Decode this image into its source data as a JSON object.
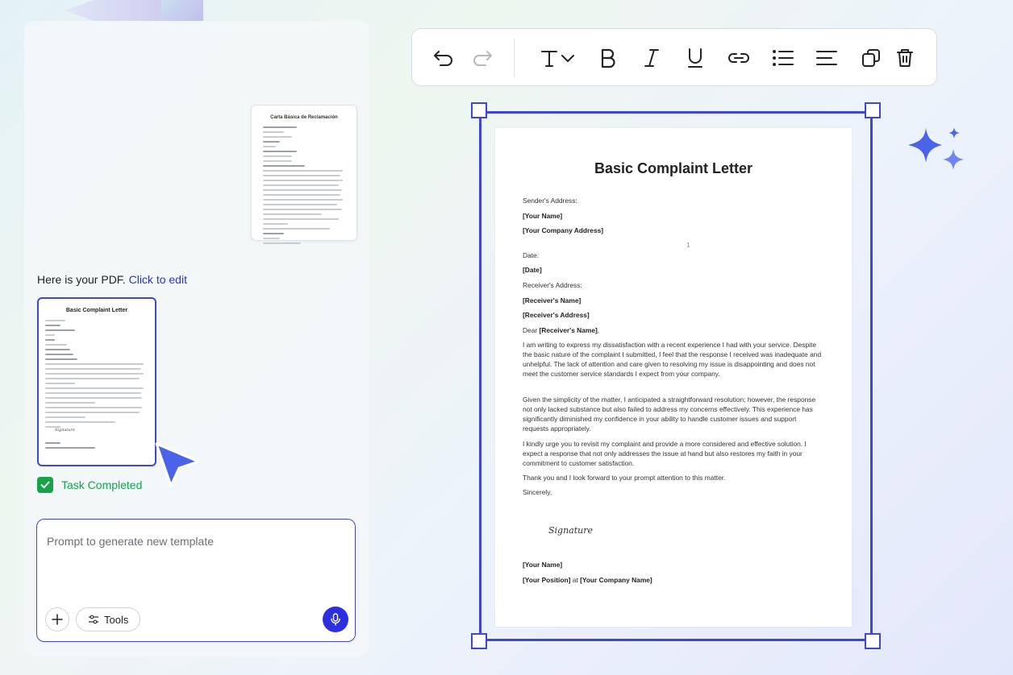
{
  "chat": {
    "reference_thumbnail": {
      "title": "Carta Básica de Reclamación"
    },
    "pdf_message": "Here is your PDF.",
    "pdf_link": "Click to edit",
    "generated_thumbnail": {
      "title": "Basic Complaint Letter",
      "signature": "Signature"
    },
    "task_status": "Task Completed",
    "prompt": {
      "placeholder": "Prompt to generate new template",
      "value": ""
    },
    "tools_label": "Tools"
  },
  "toolbar": {
    "items": [
      "undo-icon",
      "redo-icon",
      "text-style-icon",
      "chevron-down-icon",
      "bold-icon",
      "italic-icon",
      "underline-icon",
      "link-icon",
      "bullet-list-icon",
      "align-left-icon",
      "duplicate-icon",
      "delete-icon"
    ]
  },
  "document": {
    "title": "Basic Complaint Letter",
    "senders_address_label": "Sender's Address:",
    "your_name": "[Your Name]",
    "your_company_address": "[Your Company Address]",
    "page_number": "1",
    "date_label": "Date:",
    "date_value": "[Date]",
    "receivers_address_label": "Receiver's Address:",
    "receivers_name": "[Receiver's Name]",
    "receivers_address": "[Receiver's Address]",
    "dear": "Dear",
    "dear_name": "[Receiver's Name]",
    "dear_comma": ",",
    "paragraph1": "I am writing to express my dissatisfaction with a recent experience I had with your service. Despite the basic nature of the complaint I submitted, I feel that the response I received was inadequate and unhelpful. The lack of attention and care given to resolving my issue is disappointing and does not meet the customer service standards I expect from your company.",
    "paragraph2": "Given the simplicity of the matter, I anticipated a straightforward resolution; however, the response not only lacked substance but also failed to address my concerns effectively. This experience has significantly diminished my confidence in your ability to handle customer issues and support requests appropriately.",
    "paragraph3": "I kindly urge you to revisit my complaint and provide a more considered and effective solution. I expect a response that not only addresses the issue at hand but also restores my faith in your commitment to customer satisfaction.",
    "paragraph4": "Thank you and I look forward to your prompt attention to this matter.",
    "closing": "Sincerely,",
    "signature": "Signature",
    "sign_name": "[Your Name]",
    "sign_position": "[Your Position]",
    "at": "at",
    "sign_company": "[Your Company Name]"
  },
  "colors": {
    "accent": "#3d46d9",
    "success": "#16a34a",
    "mic": "#2b2fe0",
    "sparkle": "#4a63e8"
  }
}
